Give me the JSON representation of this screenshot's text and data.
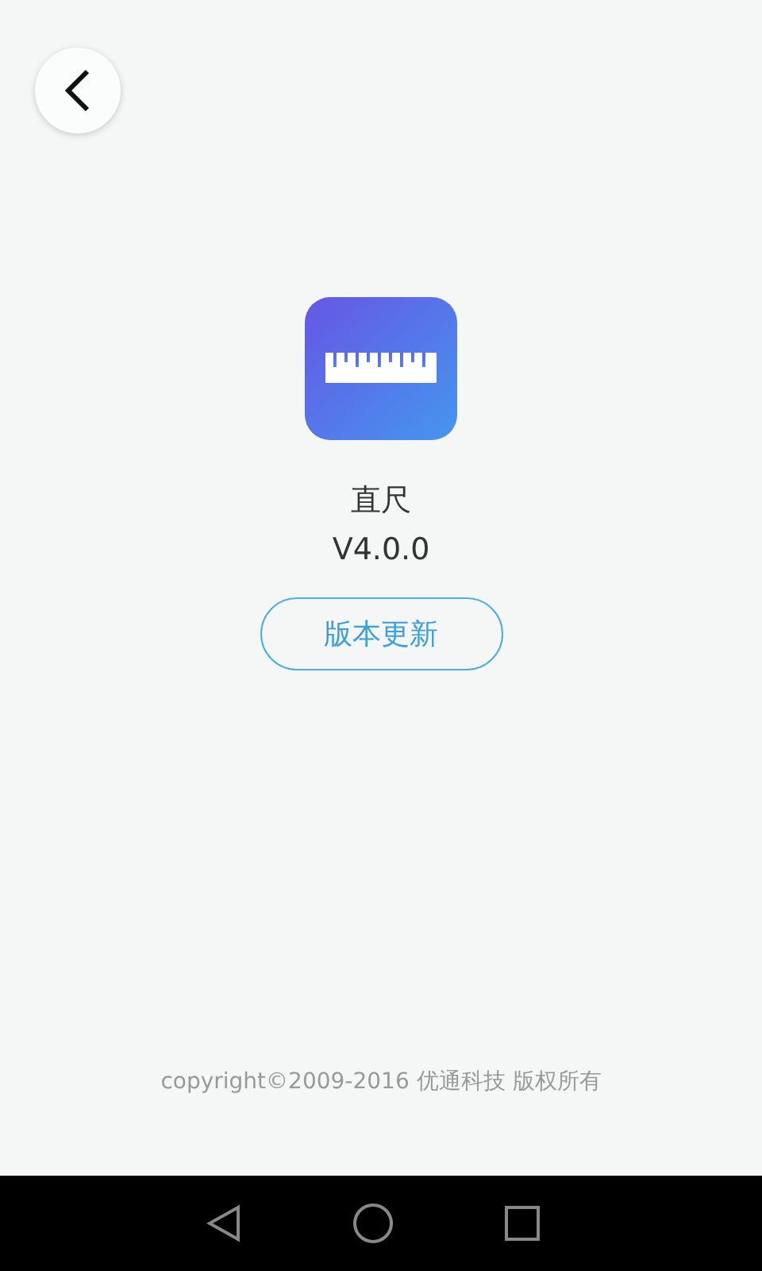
{
  "app": {
    "name": "直尺",
    "version": "V4.0.0"
  },
  "update_button": {
    "label": "版本更新"
  },
  "copyright": "copyright©2009-2016 优通科技 版权所有"
}
